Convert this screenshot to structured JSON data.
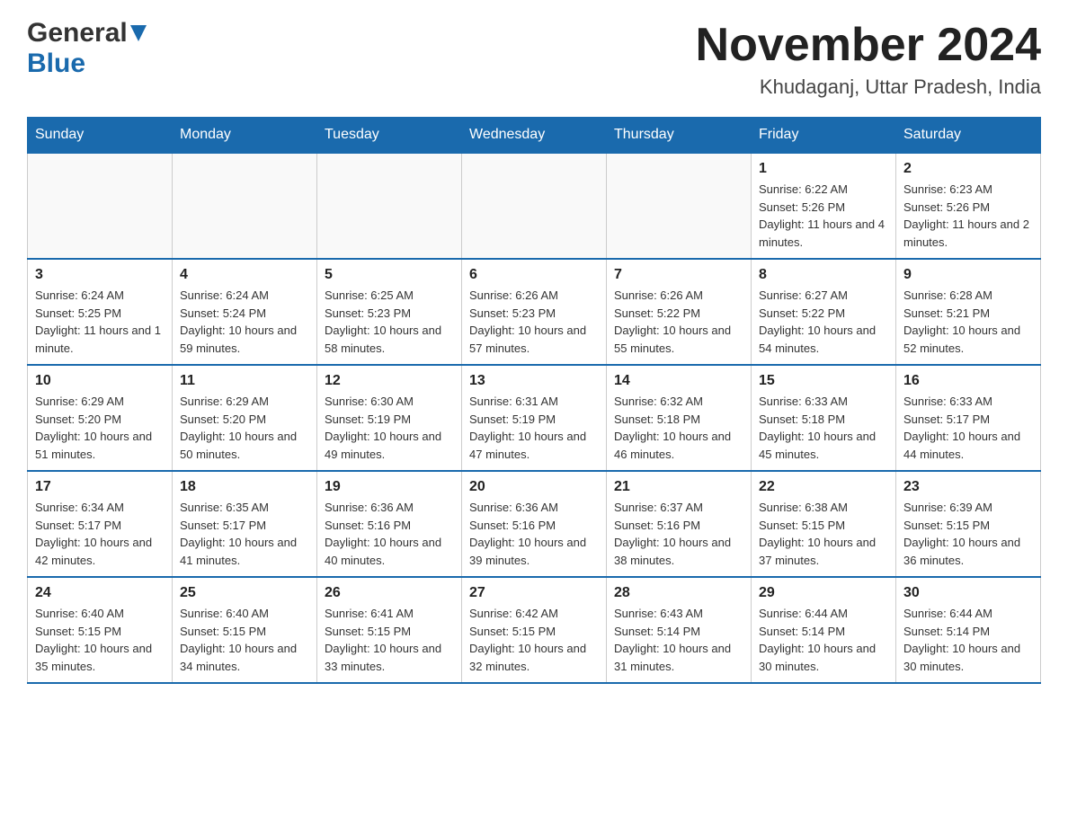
{
  "header": {
    "logo_general": "General",
    "logo_blue": "Blue",
    "month_title": "November 2024",
    "location": "Khudaganj, Uttar Pradesh, India"
  },
  "weekdays": [
    "Sunday",
    "Monday",
    "Tuesday",
    "Wednesday",
    "Thursday",
    "Friday",
    "Saturday"
  ],
  "weeks": [
    [
      {
        "day": "",
        "info": ""
      },
      {
        "day": "",
        "info": ""
      },
      {
        "day": "",
        "info": ""
      },
      {
        "day": "",
        "info": ""
      },
      {
        "day": "",
        "info": ""
      },
      {
        "day": "1",
        "info": "Sunrise: 6:22 AM\nSunset: 5:26 PM\nDaylight: 11 hours and 4 minutes."
      },
      {
        "day": "2",
        "info": "Sunrise: 6:23 AM\nSunset: 5:26 PM\nDaylight: 11 hours and 2 minutes."
      }
    ],
    [
      {
        "day": "3",
        "info": "Sunrise: 6:24 AM\nSunset: 5:25 PM\nDaylight: 11 hours and 1 minute."
      },
      {
        "day": "4",
        "info": "Sunrise: 6:24 AM\nSunset: 5:24 PM\nDaylight: 10 hours and 59 minutes."
      },
      {
        "day": "5",
        "info": "Sunrise: 6:25 AM\nSunset: 5:23 PM\nDaylight: 10 hours and 58 minutes."
      },
      {
        "day": "6",
        "info": "Sunrise: 6:26 AM\nSunset: 5:23 PM\nDaylight: 10 hours and 57 minutes."
      },
      {
        "day": "7",
        "info": "Sunrise: 6:26 AM\nSunset: 5:22 PM\nDaylight: 10 hours and 55 minutes."
      },
      {
        "day": "8",
        "info": "Sunrise: 6:27 AM\nSunset: 5:22 PM\nDaylight: 10 hours and 54 minutes."
      },
      {
        "day": "9",
        "info": "Sunrise: 6:28 AM\nSunset: 5:21 PM\nDaylight: 10 hours and 52 minutes."
      }
    ],
    [
      {
        "day": "10",
        "info": "Sunrise: 6:29 AM\nSunset: 5:20 PM\nDaylight: 10 hours and 51 minutes."
      },
      {
        "day": "11",
        "info": "Sunrise: 6:29 AM\nSunset: 5:20 PM\nDaylight: 10 hours and 50 minutes."
      },
      {
        "day": "12",
        "info": "Sunrise: 6:30 AM\nSunset: 5:19 PM\nDaylight: 10 hours and 49 minutes."
      },
      {
        "day": "13",
        "info": "Sunrise: 6:31 AM\nSunset: 5:19 PM\nDaylight: 10 hours and 47 minutes."
      },
      {
        "day": "14",
        "info": "Sunrise: 6:32 AM\nSunset: 5:18 PM\nDaylight: 10 hours and 46 minutes."
      },
      {
        "day": "15",
        "info": "Sunrise: 6:33 AM\nSunset: 5:18 PM\nDaylight: 10 hours and 45 minutes."
      },
      {
        "day": "16",
        "info": "Sunrise: 6:33 AM\nSunset: 5:17 PM\nDaylight: 10 hours and 44 minutes."
      }
    ],
    [
      {
        "day": "17",
        "info": "Sunrise: 6:34 AM\nSunset: 5:17 PM\nDaylight: 10 hours and 42 minutes."
      },
      {
        "day": "18",
        "info": "Sunrise: 6:35 AM\nSunset: 5:17 PM\nDaylight: 10 hours and 41 minutes."
      },
      {
        "day": "19",
        "info": "Sunrise: 6:36 AM\nSunset: 5:16 PM\nDaylight: 10 hours and 40 minutes."
      },
      {
        "day": "20",
        "info": "Sunrise: 6:36 AM\nSunset: 5:16 PM\nDaylight: 10 hours and 39 minutes."
      },
      {
        "day": "21",
        "info": "Sunrise: 6:37 AM\nSunset: 5:16 PM\nDaylight: 10 hours and 38 minutes."
      },
      {
        "day": "22",
        "info": "Sunrise: 6:38 AM\nSunset: 5:15 PM\nDaylight: 10 hours and 37 minutes."
      },
      {
        "day": "23",
        "info": "Sunrise: 6:39 AM\nSunset: 5:15 PM\nDaylight: 10 hours and 36 minutes."
      }
    ],
    [
      {
        "day": "24",
        "info": "Sunrise: 6:40 AM\nSunset: 5:15 PM\nDaylight: 10 hours and 35 minutes."
      },
      {
        "day": "25",
        "info": "Sunrise: 6:40 AM\nSunset: 5:15 PM\nDaylight: 10 hours and 34 minutes."
      },
      {
        "day": "26",
        "info": "Sunrise: 6:41 AM\nSunset: 5:15 PM\nDaylight: 10 hours and 33 minutes."
      },
      {
        "day": "27",
        "info": "Sunrise: 6:42 AM\nSunset: 5:15 PM\nDaylight: 10 hours and 32 minutes."
      },
      {
        "day": "28",
        "info": "Sunrise: 6:43 AM\nSunset: 5:14 PM\nDaylight: 10 hours and 31 minutes."
      },
      {
        "day": "29",
        "info": "Sunrise: 6:44 AM\nSunset: 5:14 PM\nDaylight: 10 hours and 30 minutes."
      },
      {
        "day": "30",
        "info": "Sunrise: 6:44 AM\nSunset: 5:14 PM\nDaylight: 10 hours and 30 minutes."
      }
    ]
  ]
}
